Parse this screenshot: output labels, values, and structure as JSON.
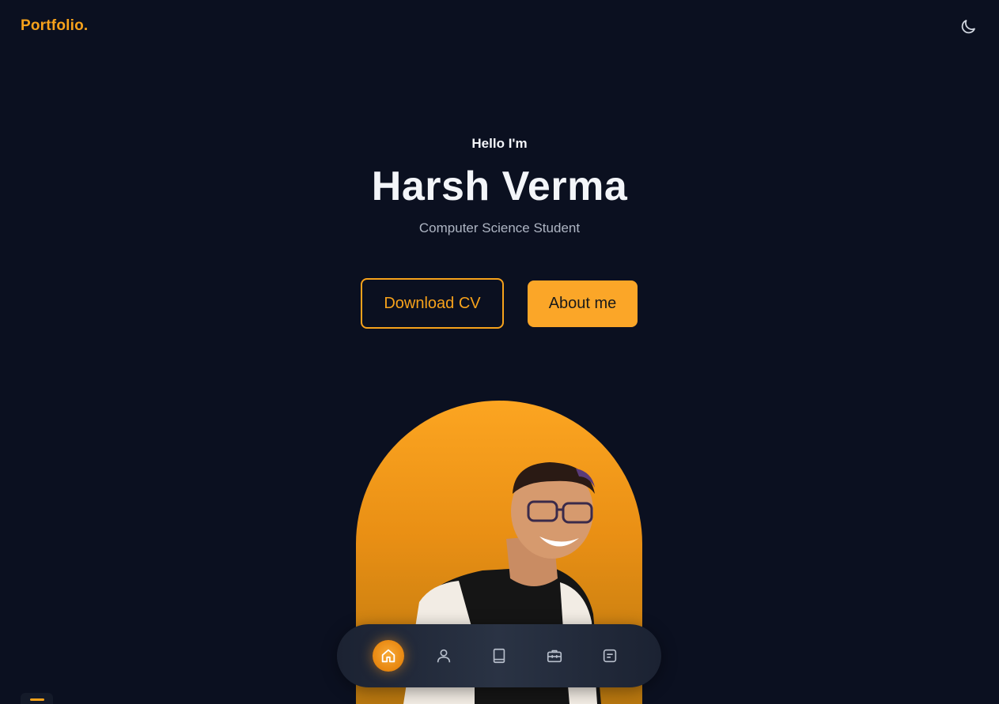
{
  "header": {
    "logo": "Portfolio.",
    "theme_toggle_icon": "moon-icon"
  },
  "hero": {
    "greeting": "Hello I'm",
    "name": "Harsh Verma",
    "role": "Computer Science Student",
    "download_cv_label": "Download CV",
    "about_me_label": "About me"
  },
  "bottom_nav": {
    "items": [
      {
        "icon": "home-icon",
        "active": true
      },
      {
        "icon": "user-icon",
        "active": false
      },
      {
        "icon": "book-icon",
        "active": false
      },
      {
        "icon": "briefcase-icon",
        "active": false
      },
      {
        "icon": "message-icon",
        "active": false
      }
    ]
  },
  "colors": {
    "background": "#0b1020",
    "accent": "#f7a21b",
    "text": "#f3f5f9",
    "muted": "#aeb5c3"
  }
}
